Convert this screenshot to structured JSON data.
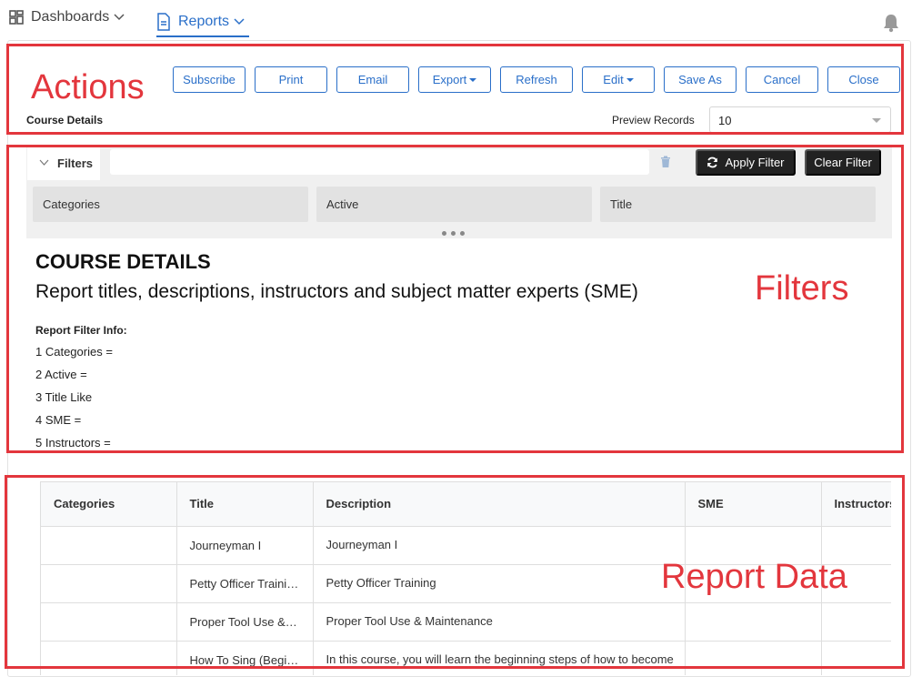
{
  "nav": {
    "dashboards_label": "Dashboards",
    "reports_label": "Reports",
    "icons": [
      "dashboard-icon",
      "report-icon",
      "chevron-down-icon",
      "bell-icon"
    ]
  },
  "annotations": {
    "actions": "Actions",
    "filters": "Filters",
    "report_data": "Report Data",
    "color": "#e3363d"
  },
  "actions": {
    "subscribe": "Subscribe",
    "print": "Print",
    "email": "Email",
    "export": "Export",
    "refresh": "Refresh",
    "edit": "Edit",
    "save_as": "Save As",
    "cancel": "Cancel",
    "close": "Close"
  },
  "report": {
    "name": "Course Details",
    "preview_label": "Preview Records",
    "preview_value": "10"
  },
  "filters": {
    "tab_label": "Filters",
    "input_value": "",
    "apply_label": "Apply Filter",
    "clear_label": "Clear Filter",
    "chips": [
      "Categories",
      "Active",
      "Title"
    ]
  },
  "report_info": {
    "heading": "COURSE DETAILS",
    "subheading": "Report titles, descriptions, instructors and subject matter experts (SME)",
    "filter_info_title": "Report Filter Info:",
    "filter_lines": [
      "1 Categories =",
      "2 Active =",
      "3 Title Like",
      "4 SME =",
      "5 Instructors ="
    ]
  },
  "table": {
    "columns": [
      "Categories",
      "Title",
      "Description",
      "SME",
      "Instructors"
    ],
    "rows": [
      {
        "categories": "",
        "title": "Journeyman I",
        "description": "Journeyman I",
        "sme": "",
        "instructors": ""
      },
      {
        "categories": "",
        "title": "Petty Officer Training",
        "description": "Petty Officer Training",
        "sme": "",
        "instructors": ""
      },
      {
        "categories": "",
        "title": "Proper Tool Use & Maintenance",
        "description": "Proper Tool Use & Maintenance",
        "sme": "",
        "instructors": ""
      },
      {
        "categories": "",
        "title": "How To Sing (Beginner)",
        "description": "In this course, you will learn the beginning steps of how to become",
        "sme": "",
        "instructors": ""
      }
    ]
  },
  "colors": {
    "accent": "#2a6fc9",
    "dark_button": "#222222",
    "annotation": "#e3363d"
  }
}
